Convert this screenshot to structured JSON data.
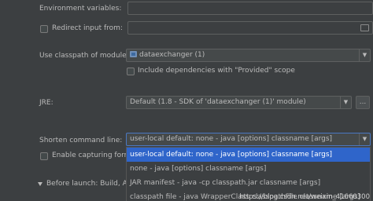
{
  "env_vars": {
    "label": "Environment variables:"
  },
  "redirect": {
    "label": "Redirect input from:"
  },
  "classpath": {
    "label": "Use classpath of module:",
    "value": "dataexchanger (1)"
  },
  "include_deps": {
    "label": "Include dependencies with \"Provided\" scope"
  },
  "jre": {
    "label": "JRE:",
    "value": "Default (1.8 - SDK of 'dataexchanger (1)' module)",
    "button": "..."
  },
  "shorten": {
    "label": "Shorten command line:",
    "value": "user-local default: none - java [options] classname [args]",
    "options": [
      "user-local default: none - java [options] classname [args]",
      "none - java [options] classname [args]",
      "JAR manifest - java -cp classpath.jar classname [args]",
      "classpath file - java WrapperClass classpathFile classname [args]"
    ]
  },
  "capturing": {
    "label": "Enable capturing form"
  },
  "before_launch": {
    "label": "Before launch: Build, Act"
  },
  "watermark": "https://blog.csdn.net/weixin_41660300"
}
